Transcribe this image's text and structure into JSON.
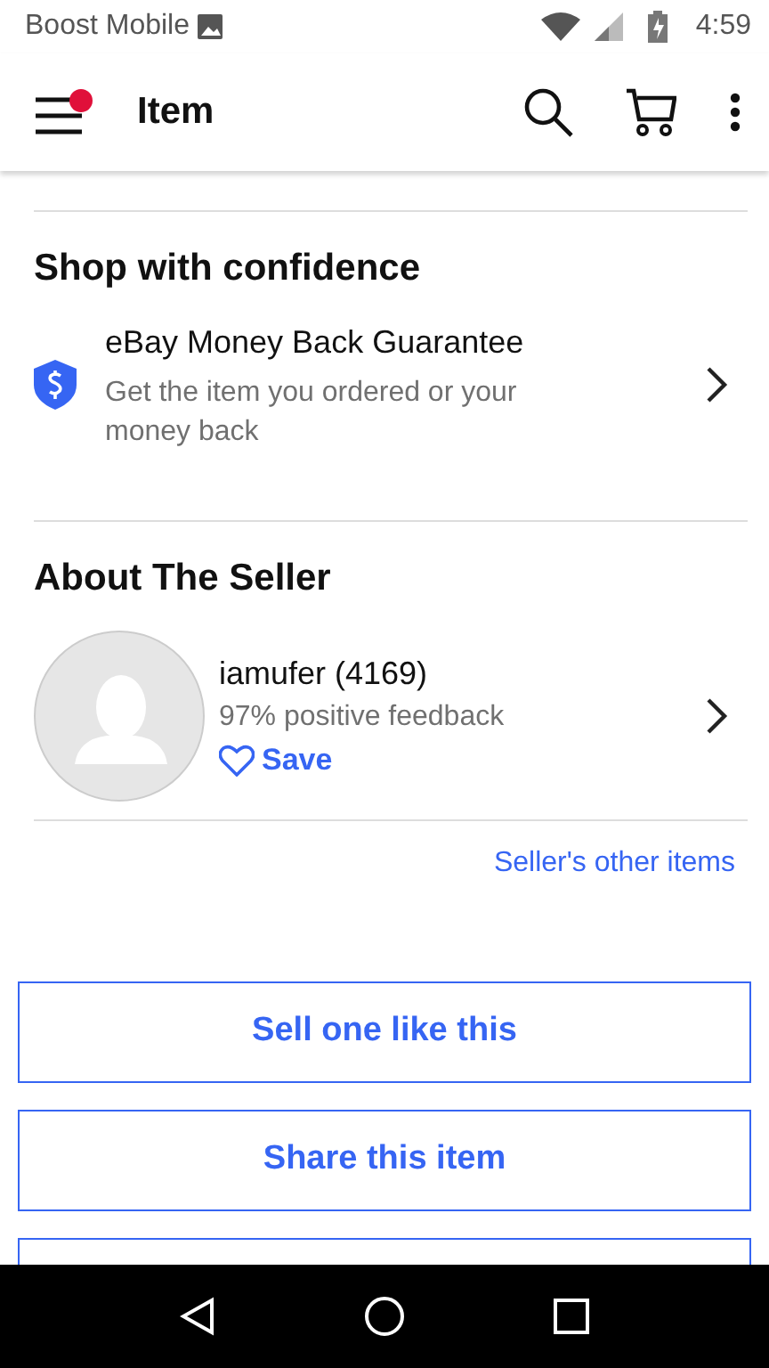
{
  "status_bar": {
    "carrier": "Boost Mobile",
    "time": "4:59"
  },
  "app_bar": {
    "title": "Item",
    "menu_notification": true
  },
  "confidence": {
    "heading": "Shop with confidence",
    "title": "eBay Money Back Guarantee",
    "subtitle": "Get the item you ordered or your money back"
  },
  "seller": {
    "heading": "About The Seller",
    "name": "iamufer (4169)",
    "feedback": "97% positive feedback",
    "save_label": "Save",
    "saved": false,
    "other_items_link": "Seller's other items"
  },
  "buttons": [
    "Sell one like this",
    "Share this item"
  ]
}
